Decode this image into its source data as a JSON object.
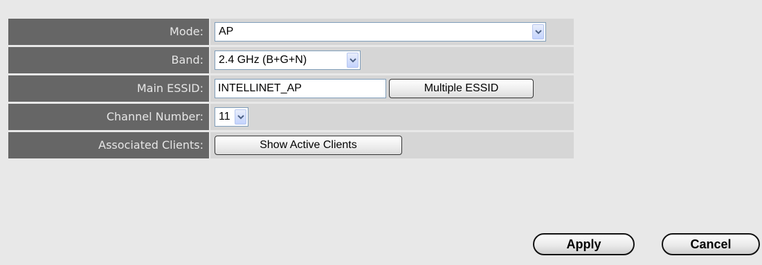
{
  "form": {
    "mode": {
      "label": "Mode:",
      "value": "AP"
    },
    "band": {
      "label": "Band:",
      "value": "2.4 GHz (B+G+N)"
    },
    "essid": {
      "label": "Main ESSID:",
      "value": "INTELLINET_AP",
      "multiple_button": "Multiple ESSID"
    },
    "channel": {
      "label": "Channel Number:",
      "value": "11"
    },
    "clients": {
      "label": "Associated Clients:",
      "button": "Show Active Clients"
    }
  },
  "actions": {
    "apply": "Apply",
    "cancel": "Cancel"
  },
  "icons": {
    "dropdown": "chevron-down-icon"
  },
  "colors": {
    "background": "#e8e8e8",
    "label_bg": "#666666",
    "label_text": "#e6e6e6",
    "value_bg": "#d6d6d6"
  }
}
